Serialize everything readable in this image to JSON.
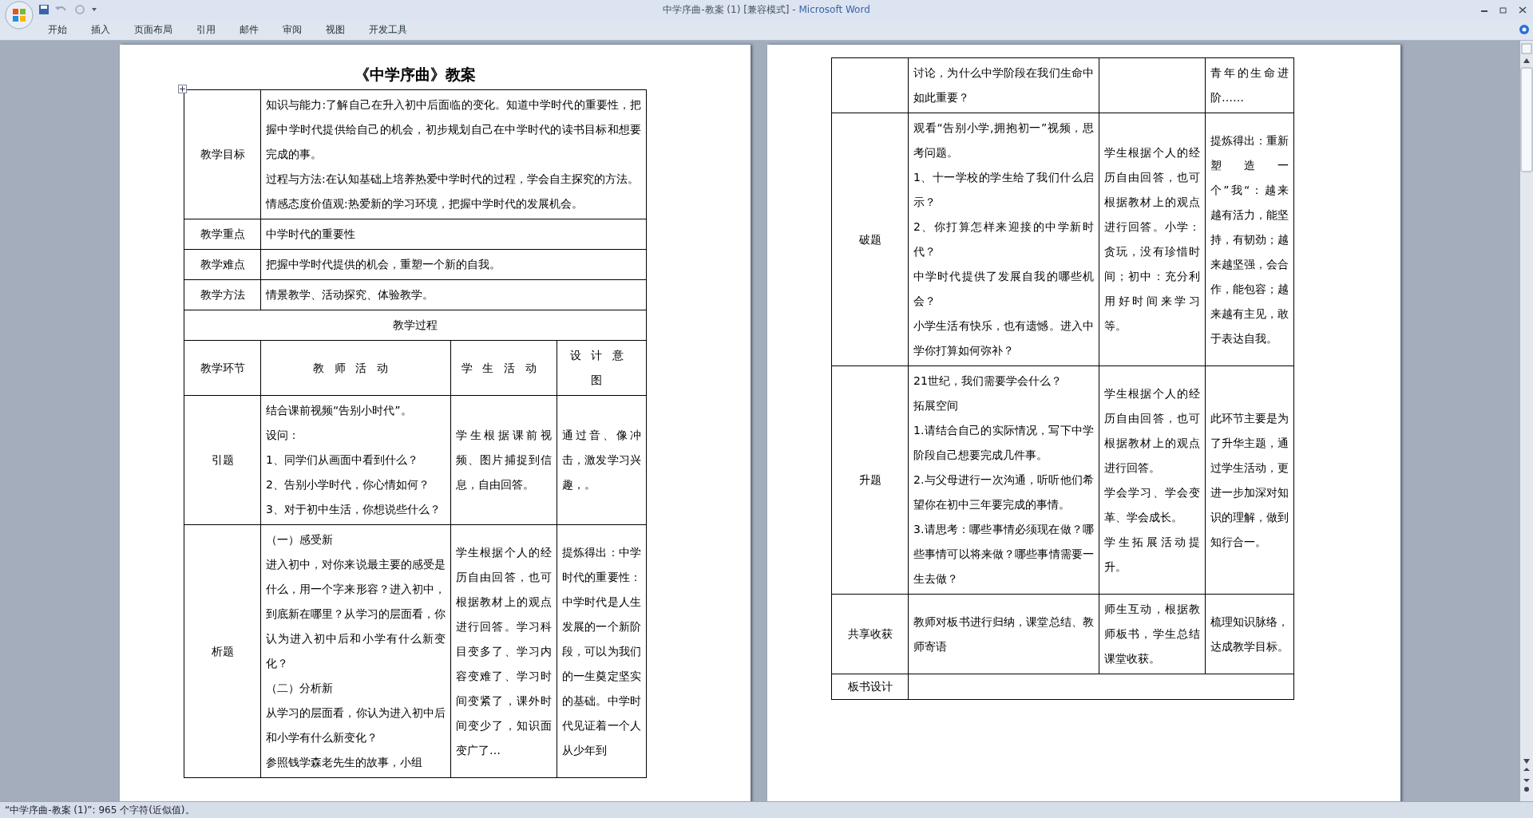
{
  "window": {
    "title": "中学序曲-教案 (1) [兼容模式]",
    "separator": " - ",
    "app": "Microsoft Word"
  },
  "ribbon_tabs": [
    "开始",
    "插入",
    "页面布局",
    "引用",
    "邮件",
    "审阅",
    "视图",
    "开发工具"
  ],
  "document": {
    "title": "《中学序曲》教案",
    "info_rows": [
      {
        "label": "教学目标",
        "paragraphs": [
          "知识与能力:了解自己在升入初中后面临的变化。知道中学时代的重要性，把握中学时代提供给自己的机会，初步规划自己在中学时代的读书目标和想要完成的事。",
          "过程与方法:在认知基础上培养热爱中学时代的过程，学会自主探究的方法。",
          "情感态度价值观:热爱新的学习环境，把握中学时代的发展机会。"
        ]
      },
      {
        "label": "教学重点",
        "paragraphs": [
          "中学时代的重要性"
        ]
      },
      {
        "label": "教学难点",
        "paragraphs": [
          "把握中学时代提供的机会，重塑一个新的自我。"
        ]
      },
      {
        "label": "教学方法",
        "paragraphs": [
          "情景教学、活动探究、体验教学。"
        ]
      }
    ],
    "process_heading": "教学过程",
    "columns": [
      "教学环节",
      "教师活动",
      "学生活动",
      "设计意图"
    ],
    "stages_page1": [
      {
        "stage": "引题",
        "teacher": [
          "结合课前视频“告别小时代”。",
          "设问：",
          "1、同学们从画面中看到什么？",
          "2、告别小学时代，你心情如何？",
          "3、对于初中生活，你想说些什么？"
        ],
        "student": [
          "学生根据课前视频、图片捕捉到信息，自由回答。"
        ],
        "intent": [
          "通过音、像冲击，激发学习兴趣，。"
        ]
      },
      {
        "stage": "析题",
        "teacher": [
          "（一）感受新",
          "进入初中，对你来说最主要的感受是什么，用一个字来形容？进入初中，到底新在哪里？从学习的层面看，你认为进入初中后和小学有什么新变化？",
          "（二）分析新",
          "从学习的层面看，你认为进入初中后和小学有什么新变化？",
          "参照钱学森老先生的故事，小组"
        ],
        "student": [
          "学生根据个人的经历自由回答，也可根据教材上的观点进行回答。学习科目变多了、学习内容变难了、学习时间变紧了，课外时间变少了，知识面变广了…"
        ],
        "intent": [
          "提炼得出：中学时代的重要性：中学时代是人生发展的一个新阶段，可以为我们的一生奠定坚实的基础。中学时代见证着一个人从少年到"
        ]
      }
    ],
    "stages_page2": [
      {
        "teacher": [
          "讨论，为什么中学阶段在我们生命中如此重要？"
        ],
        "intent": [
          "青年的生命进阶……"
        ]
      },
      {
        "stage": "破题",
        "teacher": [
          "观看“告别小学,拥抱初一”视频，思考问题。",
          "1、十一学校的学生给了我们什么启示？",
          "2、你打算怎样来迎接的中学新时代？",
          "中学时代提供了发展自我的哪些机会？",
          "小学生活有快乐，也有遗憾。进入中学你打算如何弥补？"
        ],
        "student": [
          "学生根据个人的经历自由回答，也可根据教材上的观点进行回答。小学：贪玩，没有珍惜时间；初中：充分利用好时间来学习等。"
        ],
        "intent": [
          "提炼得出：重新塑造一个”我“：越来越有活力，能坚持，有韧劲；越来越坚强，会合作，能包容；越来越有主见，敢于表达自我。"
        ]
      },
      {
        "stage": "升题",
        "teacher": [
          "21世纪，我们需要学会什么？",
          "拓展空间",
          "1.请结合自己的实际情况，写下中学阶段自己想要完成几件事。",
          "2.与父母进行一次沟通，听听他们希望你在初中三年要完成的事情。",
          "3.请思考：哪些事情必须现在做？哪些事情可以将来做？哪些事情需要一生去做？"
        ],
        "student": [
          "学生根据个人的经历自由回答，也可根据教材上的观点进行回答。",
          "学会学习、学会变革、学会成长。",
          "学生拓展活动提升。"
        ],
        "intent": [
          "此环节主要是为了升华主题，通过学生活动，更进一步加深对知识的理解，做到知行合一。"
        ]
      },
      {
        "stage": "共享收获",
        "teacher": [
          "教师对板书进行归纳，课堂总结、教师寄语"
        ],
        "student": [
          "师生互动，根据教师板书，学生总结课堂收获。"
        ],
        "intent": [
          "梳理知识脉络，达成教学目标。"
        ]
      }
    ],
    "board_label": "板书设计"
  },
  "status_bar": "“中学序曲-教案 (1)”: 965 个字符(近似值)。"
}
